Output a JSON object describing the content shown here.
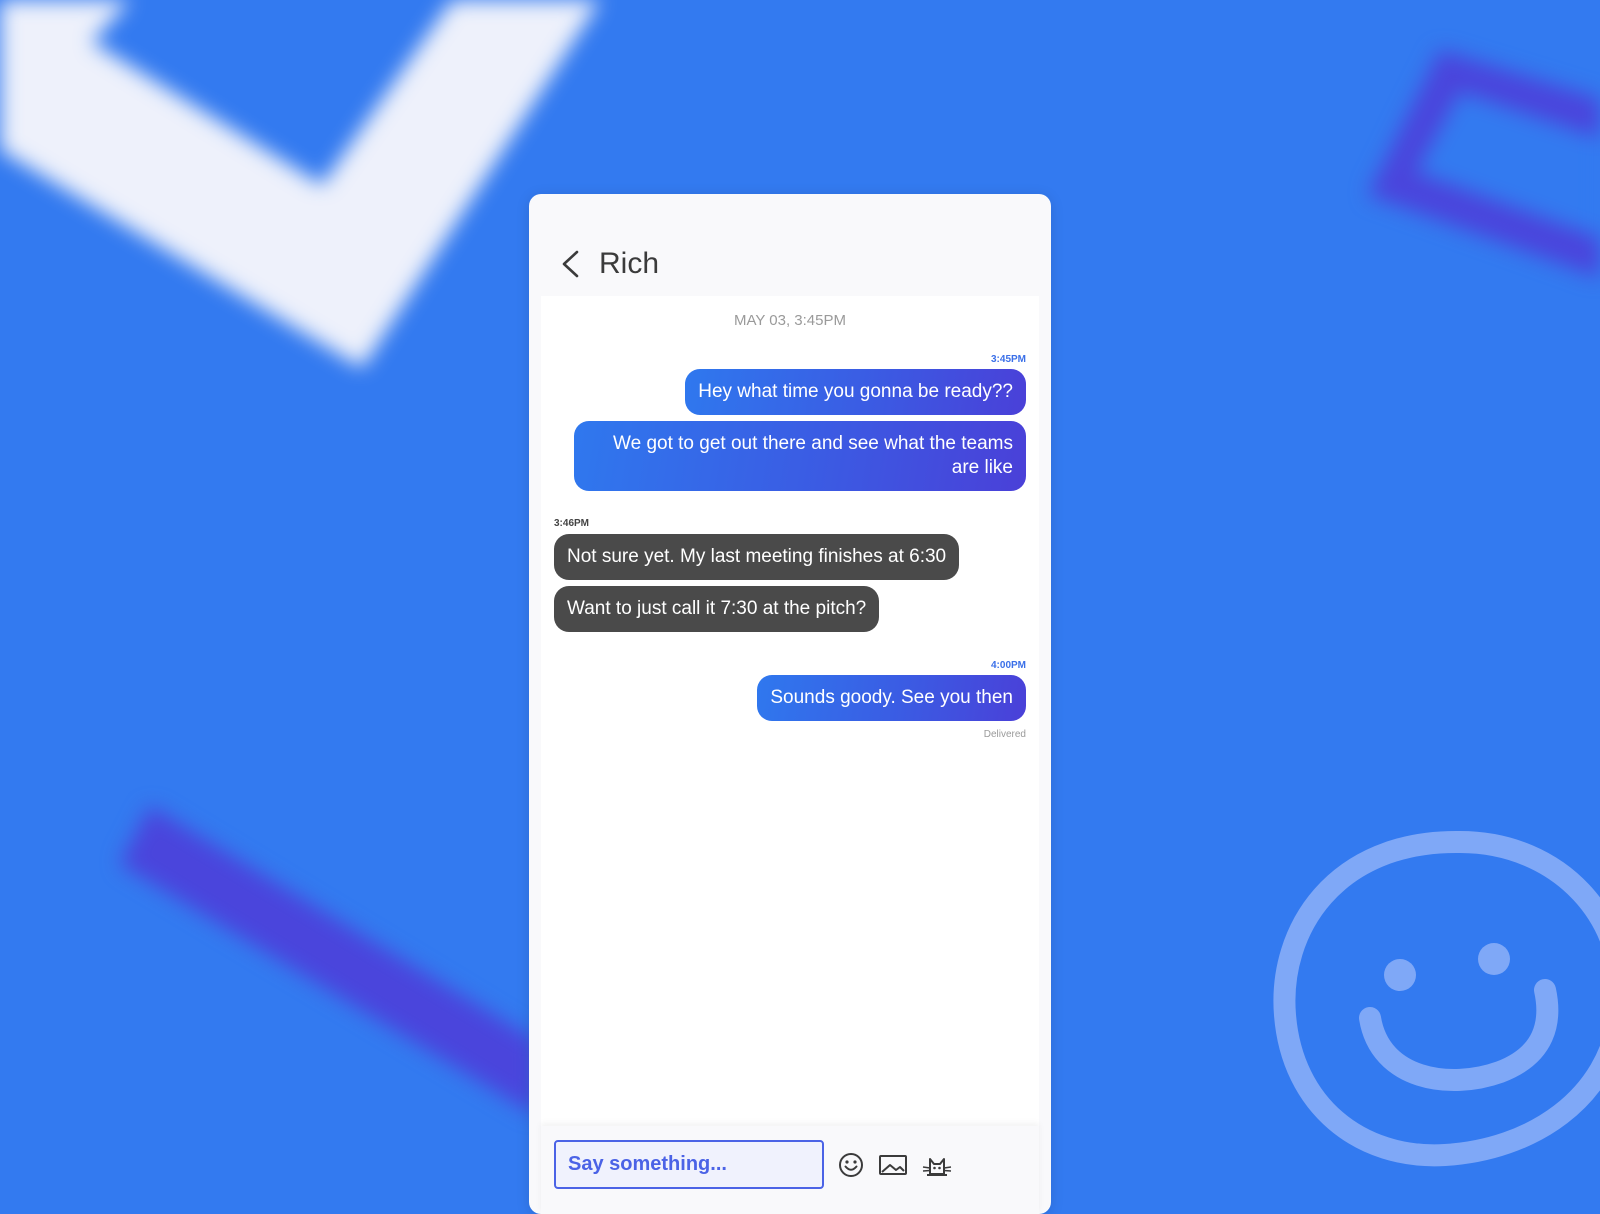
{
  "theme": {
    "background": "#337af0",
    "outgoing_bubble_start": "#2f78ee",
    "outgoing_bubble_end": "#4a40d8",
    "incoming_bubble": "#4a4a4a",
    "input_border": "#4b63e6"
  },
  "header": {
    "back_icon": "chevron-left-icon",
    "contact_name": "Rich"
  },
  "conversation": {
    "date_divider": "MAY 03, 3:45PM",
    "groups": [
      {
        "direction": "outgoing",
        "timestamp": "3:45PM",
        "messages": [
          "Hey what time you gonna be ready??",
          "We got to get out there and see what the teams are like"
        ]
      },
      {
        "direction": "incoming",
        "timestamp": "3:46PM",
        "messages": [
          "Not sure yet. My last meeting finishes at 6:30",
          "Want to just call it 7:30 at the pitch?"
        ]
      },
      {
        "direction": "outgoing",
        "timestamp": "4:00PM",
        "messages": [
          "Sounds goody. See you then"
        ]
      }
    ],
    "status": "Delivered"
  },
  "composer": {
    "placeholder": "Say something...",
    "value": "",
    "icons": [
      "emoji-icon",
      "image-icon",
      "cat-icon"
    ]
  }
}
